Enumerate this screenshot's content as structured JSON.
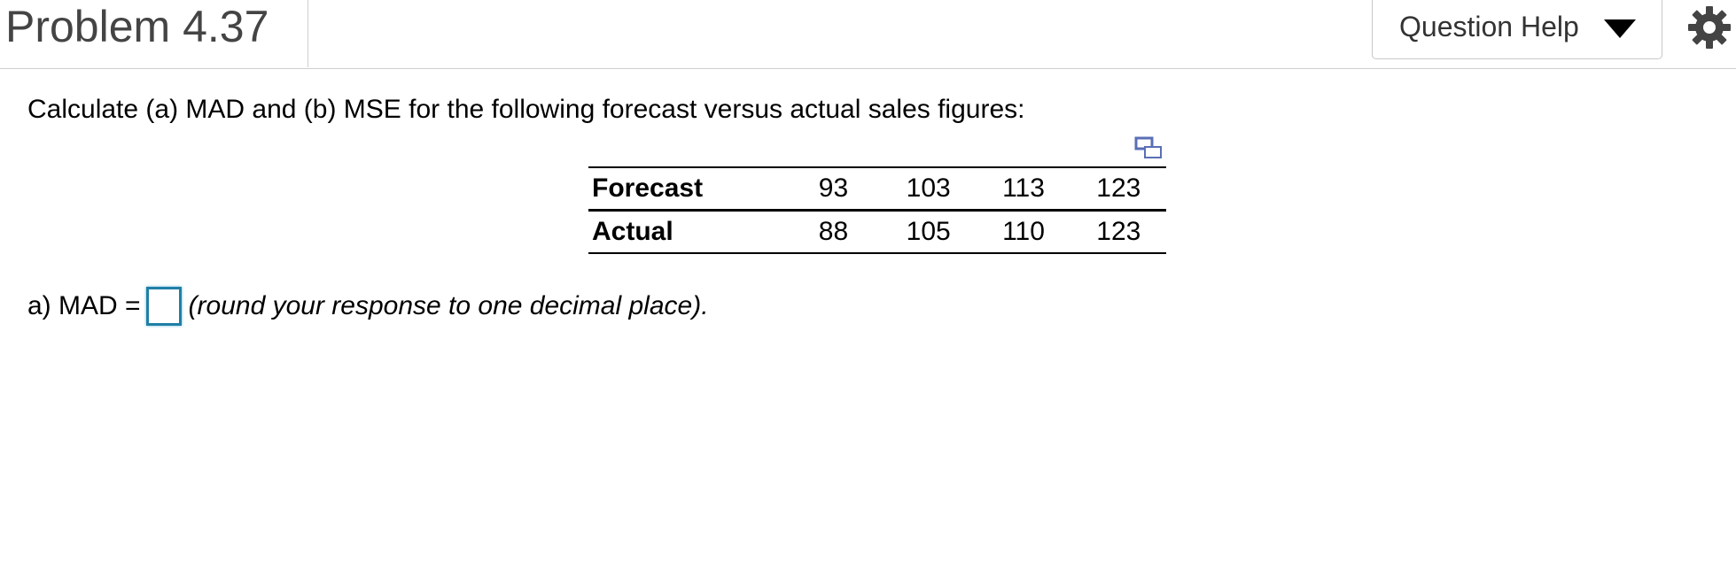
{
  "header": {
    "title": "Problem 4.37",
    "help_label": "Question Help",
    "help_icon": "caret-down-icon",
    "settings_icon": "gear-icon"
  },
  "question": {
    "text": "Calculate (a) MAD and (b) MSE for the following forecast versus actual sales figures:"
  },
  "table": {
    "rows": [
      {
        "label": "Forecast",
        "values": [
          "93",
          "103",
          "113",
          "123"
        ]
      },
      {
        "label": "Actual",
        "values": [
          "88",
          "105",
          "110",
          "123"
        ]
      }
    ]
  },
  "answer": {
    "label": "a) MAD =",
    "value": "",
    "hint": "(round your response to one decimal place)."
  },
  "colors": {
    "input_border": "#1f7fa6",
    "title_text": "#444444",
    "header_border": "#cfcfcf"
  }
}
